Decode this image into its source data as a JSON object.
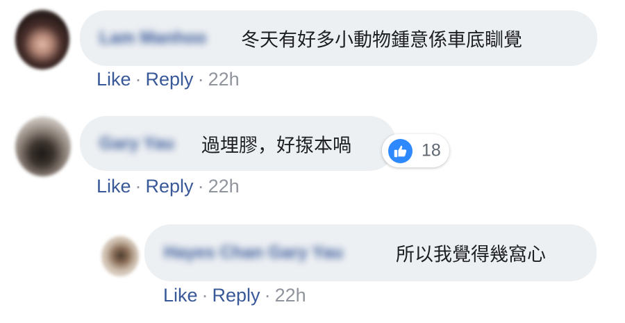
{
  "comments": [
    {
      "author": "Lam Manhoo",
      "text": "冬天有好多小動物鍾意係車底瞓覺",
      "actions": {
        "like": "Like",
        "reply": "Reply",
        "time": "22h"
      }
    },
    {
      "author": "Gary Yau",
      "text": "過埋膠，好揼本喎",
      "reactions": {
        "icon": "thumbs-up-icon",
        "count": "18"
      },
      "actions": {
        "like": "Like",
        "reply": "Reply",
        "time": "22h"
      }
    },
    {
      "author": "Hayes Chan",
      "mention": "Gary Yau",
      "text": "所以我覺得幾窩心",
      "actions": {
        "like": "Like",
        "reply": "Reply",
        "time": "22h"
      }
    }
  ],
  "colors": {
    "bubble": "#edf0f3",
    "link": "#385898",
    "meta_gray": "#90949c",
    "like_blue": "#2e89ff",
    "text": "#1c1e21"
  },
  "separator": "·"
}
